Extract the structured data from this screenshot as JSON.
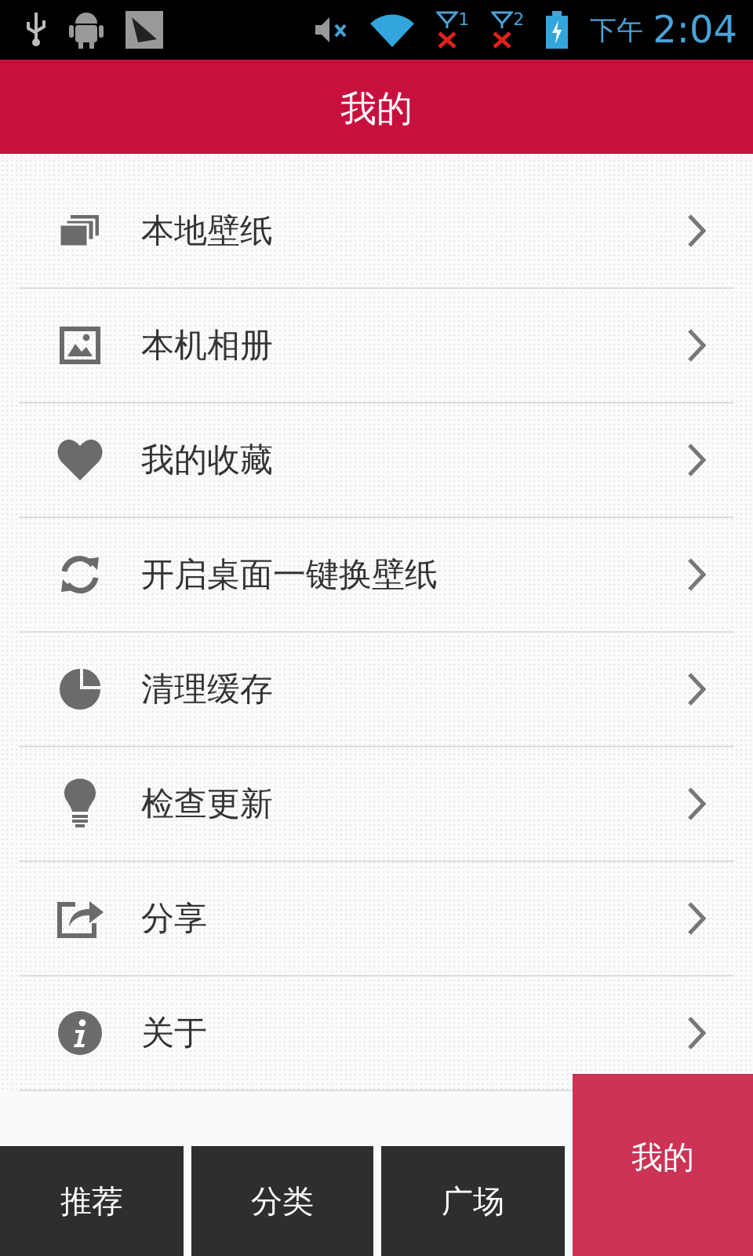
{
  "status_bar": {
    "sim1_label": "1",
    "sim2_label": "2",
    "time_period": "下午",
    "time": "2:04"
  },
  "header": {
    "title": "我的"
  },
  "menu": [
    {
      "label": "本地壁纸"
    },
    {
      "label": "本机相册"
    },
    {
      "label": "我的收藏"
    },
    {
      "label": "开启桌面一键换壁纸"
    },
    {
      "label": "清理缓存"
    },
    {
      "label": "检查更新"
    },
    {
      "label": "分享"
    },
    {
      "label": "关于"
    }
  ],
  "tabs": [
    {
      "label": "推荐",
      "selected": false
    },
    {
      "label": "分类",
      "selected": false
    },
    {
      "label": "广场",
      "selected": false
    },
    {
      "label": "我的",
      "selected": true
    }
  ]
}
